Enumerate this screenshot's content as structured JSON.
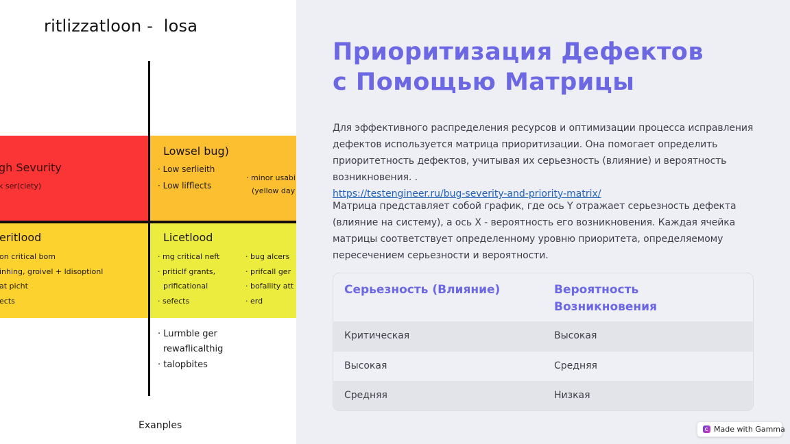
{
  "illustration": {
    "title": "ritlizzatloon -  losa",
    "caption": "Exanples",
    "colors": {
      "top_left": "#fb3535",
      "top_right": "#fbbf30",
      "bottom_left": "#fcd22f",
      "bottom_right": "#ecec3e"
    },
    "cells": {
      "top_left": {
        "header": "gh Sevurity",
        "items": [
          "k ser(ciety)"
        ]
      },
      "top_right": {
        "header": "Lowsel bug)",
        "items": [
          "· Low serlieith",
          "· Low lifflects"
        ],
        "items_col2": [
          "· minor usabili",
          "(yellow day"
        ]
      },
      "bottom_left": {
        "header": "eritlood",
        "items": [
          "on critical bom",
          "inhing, groivel  + ldisoptionl",
          "at picht",
          "ects"
        ]
      },
      "bottom_right": {
        "header": "Licetlood",
        "items": [
          "· mg critical neft",
          "· priticlf grants,",
          "prificational",
          "· sefects"
        ],
        "items_col2": [
          "· bug alcers",
          "· prifcall ger",
          "· bofallity att",
          "· erd"
        ]
      }
    },
    "below_items": [
      "· Lurmble ger",
      "rewaflicalthig",
      "· talopbites"
    ]
  },
  "slide": {
    "title_line1": "Приоритизация Дефектов",
    "title_line2": "с Помощью Матрицы",
    "paragraph1": "Для эффективного распределения ресурсов и оптимизации процесса исправления дефектов используется матрица приоритизации. Она помогает определить приоритетность дефектов, учитывая их серьезность (влияние) и вероятность возникновения. .",
    "link": "https://testengineer.ru/bug-severity-and-priority-matrix/",
    "paragraph2": "Матрица представляет собой график, где ось Y отражает серьезность дефекта (влияние на систему), а ось X - вероятность его возникновения. Каждая ячейка матрицы соответствует определенному уровню приоритета, определяемому пересечением серьезности и вероятности.",
    "accent_color": "#6c67e3",
    "table": {
      "headers": [
        "Серьезность (Влияние)",
        "Вероятность Возникновения"
      ],
      "rows": [
        [
          "Критическая",
          "Высокая"
        ],
        [
          "Высокая",
          "Средняя"
        ],
        [
          "Средняя",
          "Низкая"
        ]
      ]
    }
  },
  "badge": {
    "icon": "gamma-logo-icon",
    "label": "Made with Gamma"
  }
}
